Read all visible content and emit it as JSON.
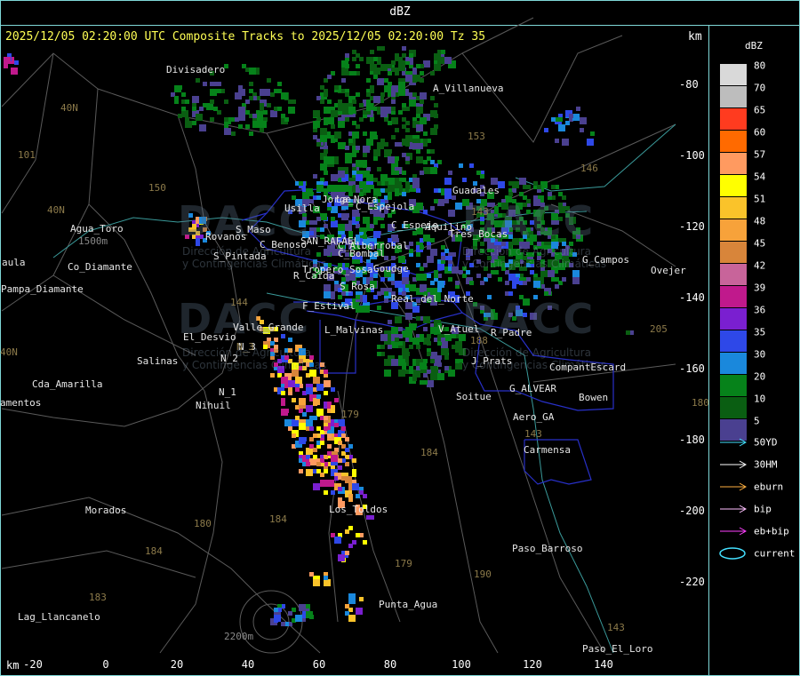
{
  "window": {
    "title": "dBZ",
    "header": "2025/12/05 02:20:00 UTC Composite Tracks to 2025/12/05 02:20:00 Tz 35",
    "km_top": "km",
    "km_bottom": "km"
  },
  "axes": {
    "x_ticks": [
      "-20",
      "0",
      "20",
      "40",
      "60",
      "80",
      "100",
      "120",
      "140"
    ],
    "y_ticks": [
      "-80",
      "-100",
      "-120",
      "-140",
      "-160",
      "-180",
      "-200",
      "-220"
    ]
  },
  "legend": {
    "title": "dBZ",
    "scale": [
      {
        "label": "80",
        "color": "#d9d9d9"
      },
      {
        "label": "70",
        "color": "#bdbdbd"
      },
      {
        "label": "65",
        "color": "#ff3b1f"
      },
      {
        "label": "60",
        "color": "#ff6a00"
      },
      {
        "label": "57",
        "color": "#ff9a60"
      },
      {
        "label": "54",
        "color": "#ffff00"
      },
      {
        "label": "51",
        "color": "#fac32a"
      },
      {
        "label": "48",
        "color": "#f7a23a"
      },
      {
        "label": "45",
        "color": "#d8853a"
      },
      {
        "label": "42",
        "color": "#c8649a"
      },
      {
        "label": "39",
        "color": "#c0198c"
      },
      {
        "label": "36",
        "color": "#7a1fd0"
      },
      {
        "label": "35",
        "color": "#2e48e8"
      },
      {
        "label": "30",
        "color": "#1a88dc"
      },
      {
        "label": "20",
        "color": "#06821a"
      },
      {
        "label": "10",
        "color": "#0a5e12"
      },
      {
        "label": "5",
        "color": "#4a4090"
      }
    ],
    "tracks": [
      {
        "label": "50YD",
        "color": "#44e0ff"
      },
      {
        "label": "30HM",
        "color": "#ffffff"
      },
      {
        "label": "eburn",
        "color": "#ffb040"
      },
      {
        "label": "bip",
        "color": "#ffc0ff"
      },
      {
        "label": "eb+bip",
        "color": "#ff40ff"
      },
      {
        "label": "current",
        "color": "#44e0ff"
      }
    ]
  },
  "places": [
    {
      "label": "Divisadero",
      "color": "#e6e6e6"
    },
    {
      "label": "A_Villanueva",
      "color": "#e6e6e6"
    },
    {
      "label": "Guadales",
      "color": "#e6e6e6"
    },
    {
      "label": "Usilla",
      "color": "#e6e6e6"
    },
    {
      "label": "La_Nora",
      "color": "#e6e6e6"
    },
    {
      "label": "C_Espejola",
      "color": "#e6e6e6"
    },
    {
      "label": "Jorge",
      "color": "#e6e6e6"
    },
    {
      "label": "C_Espejo",
      "color": "#e6e6e6"
    },
    {
      "label": "Aquilino",
      "color": "#e6e6e6"
    },
    {
      "label": "Tres_Bocas",
      "color": "#e6e6e6"
    },
    {
      "label": "Agua_Toro",
      "color": "#e6e6e6"
    },
    {
      "label": "Rovanos",
      "color": "#e6e6e6"
    },
    {
      "label": "S_Maso",
      "color": "#e6e6e6"
    },
    {
      "label": "C_Benoso",
      "color": "#e6e6e6"
    },
    {
      "label": "SAN_RAFAEL",
      "color": "#e6e6e6"
    },
    {
      "label": "C_Alberrobal",
      "color": "#e6e6e6"
    },
    {
      "label": "C_Bombal",
      "color": "#e6e6e6"
    },
    {
      "label": "G_Campos",
      "color": "#e6e6e6"
    },
    {
      "label": "Ovejer",
      "color": "#e6e6e6"
    },
    {
      "label": "aula",
      "color": "#e6e6e6"
    },
    {
      "label": "Co_Diamante",
      "color": "#e6e6e6"
    },
    {
      "label": "S_Pintada",
      "color": "#e6e6e6"
    },
    {
      "label": "Tropero_Sosa",
      "color": "#e6e6e6"
    },
    {
      "label": "Goudge",
      "color": "#e6e6e6"
    },
    {
      "label": "Pampa_Diamante",
      "color": "#e6e6e6"
    },
    {
      "label": "R_Caida",
      "color": "#e6e6e6"
    },
    {
      "label": "S_Rosa",
      "color": "#e6e6e6"
    },
    {
      "label": "Real_del_Norte",
      "color": "#e6e6e6"
    },
    {
      "label": "F_Estival",
      "color": "#e6e6e6"
    },
    {
      "label": "Valle_Grande",
      "color": "#e6e6e6"
    },
    {
      "label": "L_Malvinas",
      "color": "#e6e6e6"
    },
    {
      "label": "V_Atuel",
      "color": "#e6e6e6"
    },
    {
      "label": "R_Padre",
      "color": "#e6e6e6"
    },
    {
      "label": "El_Desvio",
      "color": "#e6e6e6"
    },
    {
      "label": "Salinas",
      "color": "#e6e6e6"
    },
    {
      "label": "N_3",
      "color": "#e6e6e6"
    },
    {
      "label": "N_2",
      "color": "#e6e6e6"
    },
    {
      "label": "J_Prats",
      "color": "#e6e6e6"
    },
    {
      "label": "CompantEscard",
      "color": "#e6e6e6"
    },
    {
      "label": "Cda_Amarilla",
      "color": "#e6e6e6"
    },
    {
      "label": "N_1",
      "color": "#e6e6e6"
    },
    {
      "label": "G_ALVEAR",
      "color": "#e6e6e6"
    },
    {
      "label": "Soitue",
      "color": "#e6e6e6"
    },
    {
      "label": "Bowen",
      "color": "#e6e6e6"
    },
    {
      "label": "amentos",
      "color": "#e6e6e6"
    },
    {
      "label": "Nihuil",
      "color": "#e6e6e6"
    },
    {
      "label": "Aero_GA",
      "color": "#e6e6e6"
    },
    {
      "label": "Carmensa",
      "color": "#e6e6e6"
    },
    {
      "label": "Los_Toldos",
      "color": "#e6e6e6"
    },
    {
      "label": "Morados",
      "color": "#e6e6e6"
    },
    {
      "label": "Paso_Barroso",
      "color": "#e6e6e6"
    },
    {
      "label": "Punta_Agua",
      "color": "#e6e6e6"
    },
    {
      "label": "Lag_Llancanelo",
      "color": "#e6e6e6"
    },
    {
      "label": "Paso_El_Loro",
      "color": "#e6e6e6"
    }
  ],
  "route_numbers": [
    "40N",
    "101",
    "40N",
    "150",
    "153",
    "146",
    "143",
    "144",
    "40N",
    "N_3",
    "179",
    "184",
    "188",
    "180",
    "184",
    "179",
    "190",
    "183",
    "184",
    "143",
    "143",
    "205",
    "180"
  ],
  "elevations": [
    "1500m",
    "2200m"
  ],
  "watermark": {
    "brand": "DACC",
    "line1": "Dirección de Agricultura",
    "line2": "y Contingencias Climáticas"
  }
}
